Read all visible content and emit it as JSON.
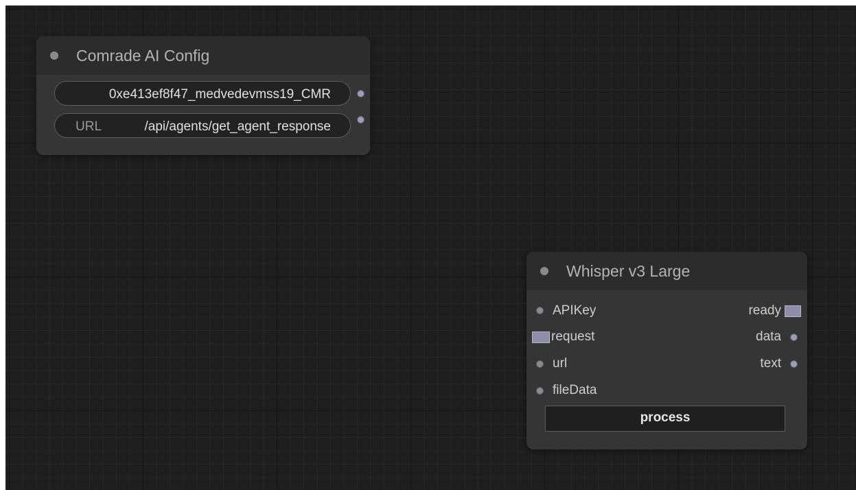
{
  "colors": {
    "canvas_bg": "#1e1e1e",
    "node_bg": "#353535",
    "node_title_bg": "#2c2c2c",
    "slot": "#9d9db4"
  },
  "config_node": {
    "title": "Comrade AI Config",
    "widgets": [
      {
        "label": "",
        "value": "0xe413ef8f47_medvedevmss19_CMR"
      },
      {
        "label": "URL",
        "value": "/api/agents/get_agent_response"
      }
    ]
  },
  "whisper_node": {
    "title": "Whisper v3 Large",
    "inputs": [
      "APIKey",
      "request",
      "url",
      "fileData"
    ],
    "outputs": [
      "ready",
      "data",
      "text"
    ],
    "button_label": "process"
  }
}
